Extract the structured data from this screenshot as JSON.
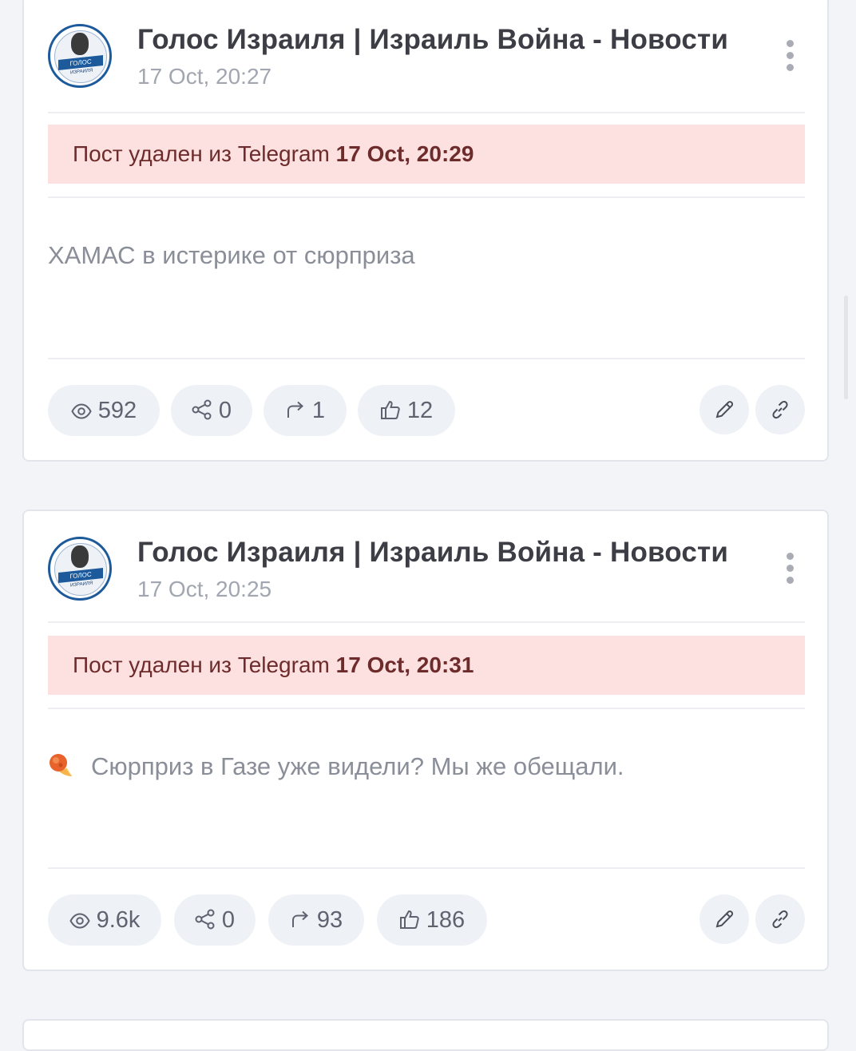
{
  "posts": [
    {
      "channel_name": "Голос Израиля | Израиль Война - Новости",
      "date": "17 Oct, 20:27",
      "deleted_prefix": "Пост удален из Telegram",
      "deleted_date": "17 Oct, 20:29",
      "text": "ХАМАС в истерике от сюрприза",
      "views": "592",
      "shares": "0",
      "forwards": "1",
      "likes": "12"
    },
    {
      "channel_name": "Голос Израиля | Израиль Война - Новости",
      "date": "17 Oct, 20:25",
      "deleted_prefix": "Пост удален из Telegram",
      "deleted_date": "17 Oct, 20:31",
      "text": "Сюрприз в Газе уже видели? Мы же обещали.",
      "text_icon": "fire-meteor-icon",
      "views": "9.6k",
      "shares": "0",
      "forwards": "93",
      "likes": "186"
    }
  ],
  "avatar": {
    "band_text": "ГОЛОС",
    "sub_text": "ИЗРАИЛЯ"
  },
  "colors": {
    "deleted_bg": "#fce1e0",
    "deleted_text": "#6e2b2b",
    "pill_bg": "#eef1f6",
    "brand_blue": "#1d5a9c"
  }
}
